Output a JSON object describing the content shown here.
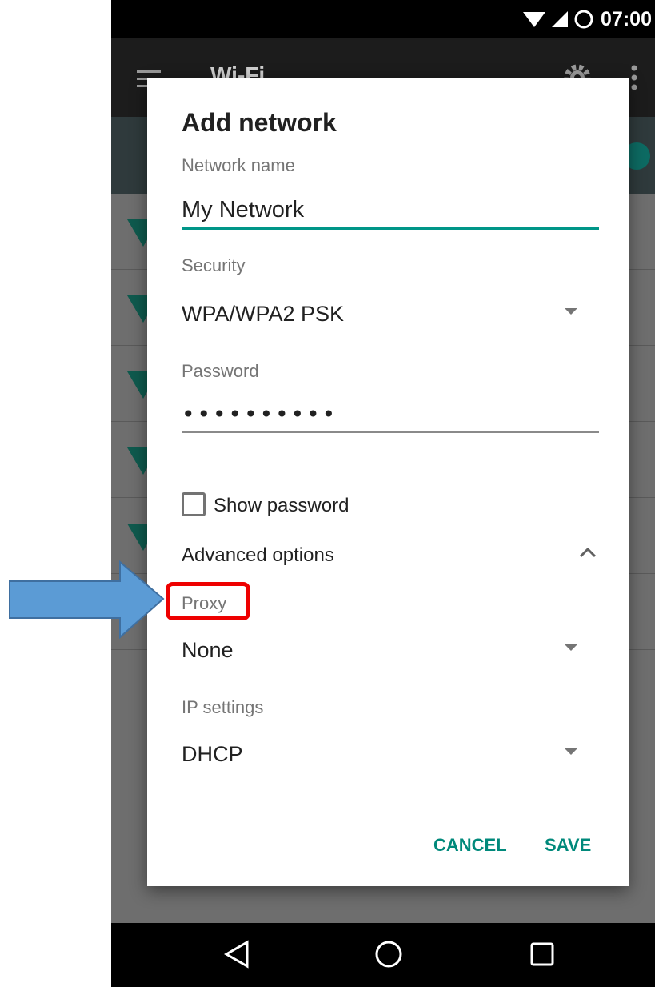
{
  "status_bar": {
    "time": "07:00",
    "icons": [
      "wifi-icon",
      "signal-icon",
      "battery-icon"
    ]
  },
  "app_bar": {
    "title": "Wi-Fi",
    "icons": [
      "menu-icon",
      "gear-icon",
      "more-vert-icon"
    ]
  },
  "dialog": {
    "title": "Add network",
    "network_name": {
      "label": "Network name",
      "value": "My Network"
    },
    "security": {
      "label": "Security",
      "value": "WPA/WPA2 PSK"
    },
    "password": {
      "label": "Password",
      "value": "••••••••••"
    },
    "show_password": {
      "label": "Show password",
      "checked": false
    },
    "advanced": {
      "label": "Advanced options",
      "expanded": true
    },
    "proxy": {
      "label": "Proxy",
      "value": "None"
    },
    "ip_settings": {
      "label": "IP settings",
      "value": "DHCP"
    },
    "cancel_label": "CANCEL",
    "save_label": "SAVE"
  },
  "annotation": {
    "highlight_color": "#ee0000",
    "arrow_color": "#5b9bd5"
  },
  "colors": {
    "accent": "#009688",
    "button_text": "#00897b"
  },
  "nav_bar": {
    "icons": [
      "back-icon",
      "home-icon",
      "recents-icon"
    ]
  }
}
